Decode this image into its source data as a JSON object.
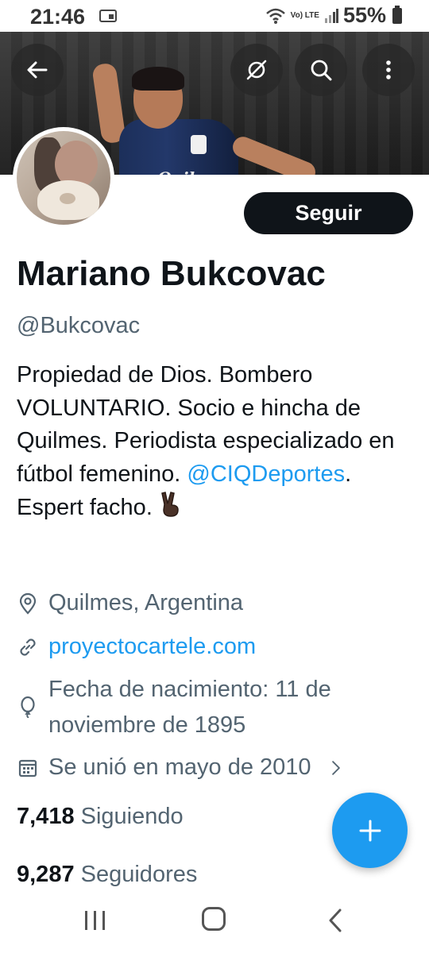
{
  "status_bar": {
    "time": "21:46",
    "network_label": "Vo) LTE",
    "battery_percent": "55%"
  },
  "header": {
    "banner_jersey_text": "Quilmes",
    "back_icon": "arrow-left-icon",
    "mute_icon": "slash-circle-icon",
    "search_icon": "search-icon",
    "more_icon": "more-vertical-icon"
  },
  "profile": {
    "follow_label": "Seguir",
    "name": "Mariano Bukcovac",
    "handle": "@Bukcovac",
    "bio_part1": "Propiedad de Dios. Bombero VOLUNTARIO. Socio e hincha de Quilmes. Periodista especializado en fútbol femenino. ",
    "bio_mention": "@CIQDeportes",
    "bio_part2": ". Espert facho. ",
    "bio_emoji": "✌🏿",
    "location": "Quilmes, Argentina",
    "website": "proyectocartele.com",
    "birthdate": "Fecha de nacimiento: 11 de noviembre de 1895",
    "joined": "Se unió en mayo de 2010",
    "following_count": "7,418",
    "following_label": "Siguiendo",
    "followers_count": "9,287",
    "followers_label": "Seguidores"
  },
  "colors": {
    "accent": "#1d9bf0",
    "text_primary": "#0f1419",
    "text_secondary": "#536471",
    "follow_button_bg": "#0f1419"
  }
}
